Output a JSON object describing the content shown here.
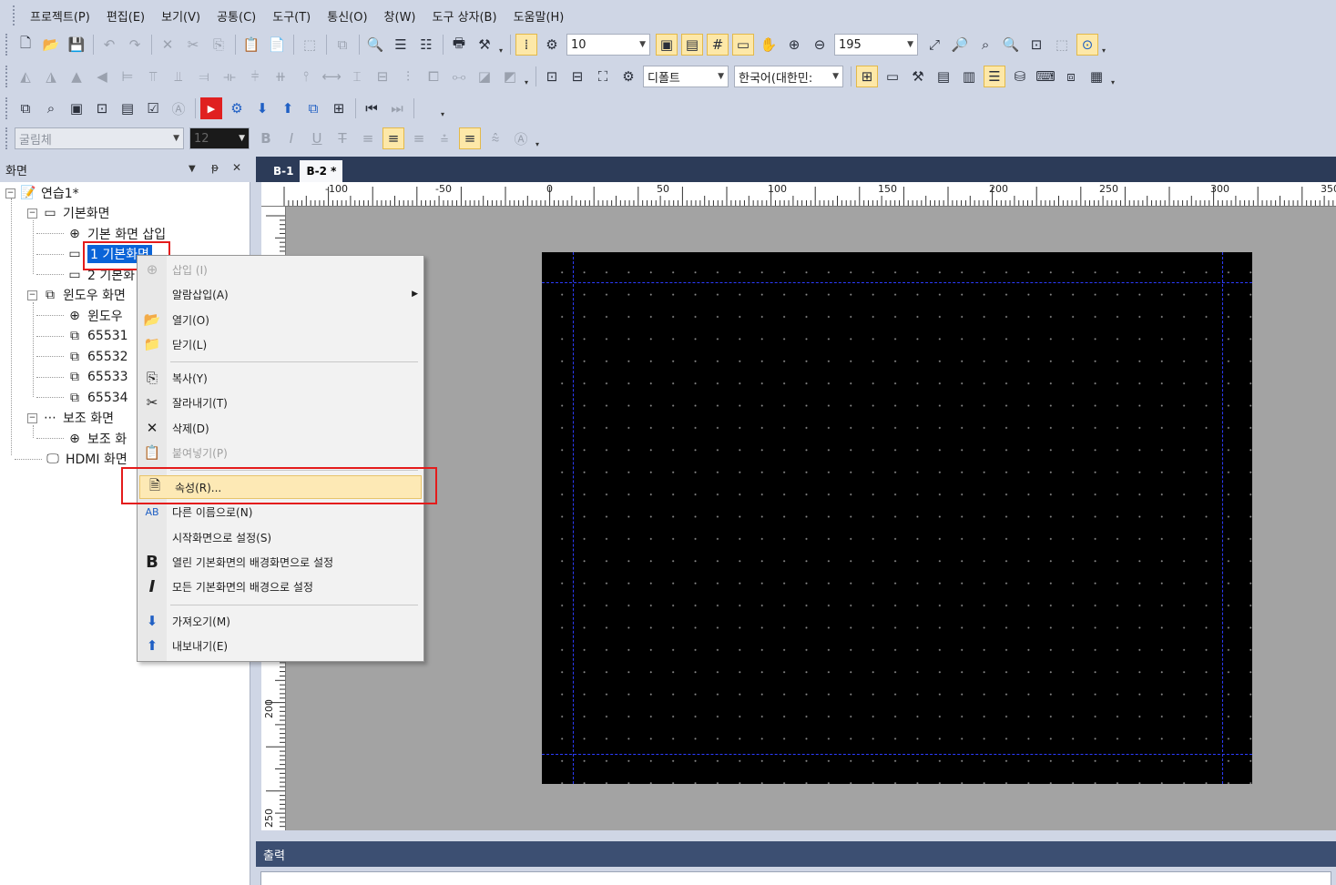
{
  "menubar": [
    "프로젝트(P)",
    "편집(E)",
    "보기(V)",
    "공통(C)",
    "도구(T)",
    "통신(O)",
    "창(W)",
    "도구 상자(B)",
    "도움말(H)"
  ],
  "toolbar": {
    "grid_spacing": "10",
    "zoom": "195",
    "style_combo": "디폴트",
    "language_combo": "한국어(대한민:",
    "font_combo": "굴림체",
    "font_size": "12"
  },
  "panel": {
    "title": "화면",
    "pin": "ᵽ",
    "close": "✕",
    "dropdown": "▼"
  },
  "tree": {
    "project": "연습1*",
    "base_screens": "기본화면",
    "insert_base": "기본 화면 삽입",
    "base1": "1 기본화면",
    "base2": "2 기본화",
    "window_screens": "윈도우 화면",
    "window_insert": "윈도우",
    "w1": "65531",
    "w2": "65532",
    "w3": "65533",
    "w4": "65534",
    "sub_screens": "보조 화면",
    "sub_insert": "보조 화",
    "hdmi": "HDMI 화면"
  },
  "context_menu": {
    "insert": "삽입 (I)",
    "insert_alarm": "알람삽입(A)",
    "open": "열기(O)",
    "close": "닫기(L)",
    "copy": "복사(Y)",
    "cut": "잘라내기(T)",
    "delete": "삭제(D)",
    "paste": "붙여넣기(P)",
    "properties": "속성(R)...",
    "rename": "다른 이름으로(N)",
    "set_start": "시작화면으로 설정(S)",
    "set_bg_open": "열린 기본화면의 배경화면으로 설정",
    "set_bg_all": "모든 기본화면의 배경으로 설정",
    "import": "가져오기(M)",
    "export": "내보내기(E)"
  },
  "doc_tabs": [
    "B-1",
    "B-2 *"
  ],
  "ruler": {
    "top": [
      "-100",
      "-50",
      "0",
      "50",
      "100",
      "150",
      "200",
      "250",
      "300",
      "350"
    ],
    "left": [
      "200",
      "250"
    ]
  },
  "output": {
    "title": "출력"
  }
}
